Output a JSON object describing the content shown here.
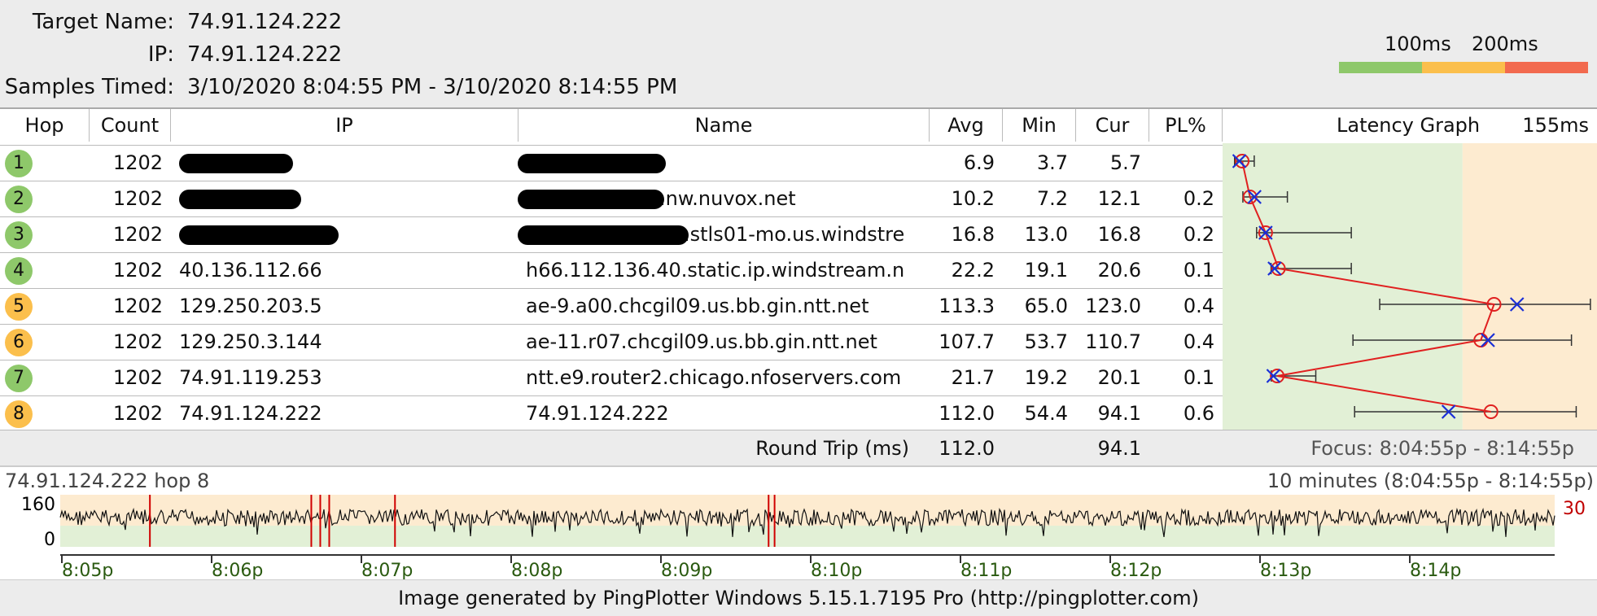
{
  "header": {
    "target_name_label": "Target Name:",
    "target_name": "74.91.124.222",
    "ip_label": "IP:",
    "ip": "74.91.124.222",
    "samples_label": "Samples Timed:",
    "samples": "3/10/2020 8:04:55 PM - 3/10/2020 8:14:55 PM"
  },
  "scale": {
    "label_100": "100ms",
    "label_200": "200ms",
    "colors": [
      "#8ec86a",
      "#fbbf4c",
      "#f26a4f"
    ]
  },
  "columns": {
    "hop": "Hop",
    "count": "Count",
    "ip": "IP",
    "name": "Name",
    "avg": "Avg",
    "min": "Min",
    "cur": "Cur",
    "pl": "PL%",
    "graph": "Latency Graph",
    "graph_max": "155ms"
  },
  "hops": [
    {
      "hop": "1",
      "count": "1202",
      "ip": "",
      "name": "",
      "avg": "6.9",
      "min": "3.7",
      "cur": "5.7",
      "pl": "",
      "color": "#8ec86a",
      "max": 12.0
    },
    {
      "hop": "2",
      "count": "1202",
      "ip": "",
      "name": ".nw.nuvox.net",
      "avg": "10.2",
      "min": "7.2",
      "cur": "12.1",
      "pl": "0.2",
      "color": "#8ec86a",
      "max": 26.0
    },
    {
      "hop": "3",
      "count": "1202",
      "ip": "",
      "name": ".stls01-mo.us.windstre",
      "avg": "16.8",
      "min": "13.0",
      "cur": "16.8",
      "pl": "0.2",
      "color": "#8ec86a",
      "max": 53.0
    },
    {
      "hop": "4",
      "count": "1202",
      "ip": "40.136.112.66",
      "name": "h66.112.136.40.static.ip.windstream.n",
      "avg": "22.2",
      "min": "19.1",
      "cur": "20.6",
      "pl": "0.1",
      "color": "#8ec86a",
      "max": 53.0
    },
    {
      "hop": "5",
      "count": "1202",
      "ip": "129.250.203.5",
      "name": "ae-9.a00.chcgil09.us.bb.gin.ntt.net",
      "avg": "113.3",
      "min": "65.0",
      "cur": "123.0",
      "pl": "0.4",
      "color": "#fbbf4c",
      "max": 154.0
    },
    {
      "hop": "6",
      "count": "1202",
      "ip": "129.250.3.144",
      "name": "ae-11.r07.chcgil09.us.bb.gin.ntt.net",
      "avg": "107.7",
      "min": "53.7",
      "cur": "110.7",
      "pl": "0.4",
      "color": "#fbbf4c",
      "max": 146.0
    },
    {
      "hop": "7",
      "count": "1202",
      "ip": "74.91.119.253",
      "name": "ntt.e9.router2.chicago.nfoservers.com",
      "avg": "21.7",
      "min": "19.2",
      "cur": "20.1",
      "pl": "0.1",
      "color": "#8ec86a",
      "max": 38.0
    },
    {
      "hop": "8",
      "count": "1202",
      "ip": "74.91.124.222",
      "name": "74.91.124.222",
      "avg": "112.0",
      "min": "54.4",
      "cur": "94.1",
      "pl": "0.6",
      "color": "#fbbf4c",
      "max": 148.0
    }
  ],
  "round_trip": {
    "label": "Round Trip (ms)",
    "avg": "112.0",
    "cur": "94.1",
    "focus": "Focus: 8:04:55p - 8:14:55p"
  },
  "timeline": {
    "title": "74.91.124.222 hop 8",
    "range": "10 minutes (8:04:55p - 8:14:55p)",
    "y_top": "160",
    "y_bottom": "0",
    "right_value": "30",
    "ticks": [
      "8:05p",
      "8:06p",
      "8:07p",
      "8:08p",
      "8:09p",
      "8:10p",
      "8:11p",
      "8:12p",
      "8:13p",
      "8:14p"
    ],
    "loss_events": [
      0.06,
      0.168,
      0.174,
      0.18,
      0.224,
      0.474,
      0.478
    ]
  },
  "footer": "Image generated by PingPlotter Windows 5.15.1.7195 Pro (http://pingplotter.com)"
}
